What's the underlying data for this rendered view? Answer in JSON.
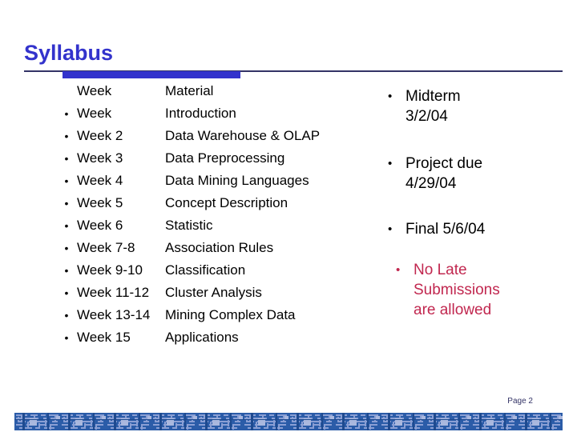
{
  "slide": {
    "title": "Syllabus",
    "page_number": "Page 2",
    "title_color": "#3333CC",
    "accent_color": "#C1274F",
    "rule_color": "#333366",
    "footer_band_color": "#2B5CA8"
  },
  "schedule": {
    "bullet_glyph": "•",
    "header": {
      "week": "Week",
      "material": "Material"
    },
    "rows": [
      {
        "week": "Week",
        "material": "Introduction"
      },
      {
        "week": "Week 2",
        "material": "Data Warehouse & OLAP"
      },
      {
        "week": "Week 3",
        "material": "Data Preprocessing"
      },
      {
        "week": "Week 4",
        "material": "Data Mining Languages"
      },
      {
        "week": "Week 5",
        "material": "Concept Description"
      },
      {
        "week": "Week 6",
        "material": "Statistic"
      },
      {
        "week": "Week 7-8",
        "material": "Association Rules"
      },
      {
        "week": "Week 9-10",
        "material": "Classification"
      },
      {
        "week": "Week 11-12",
        "material": "Cluster Analysis"
      },
      {
        "week": "Week 13-14",
        "material": "Mining Complex Data"
      },
      {
        "week": "Week 15",
        "material": "Applications"
      }
    ]
  },
  "notes": {
    "bullet_glyph": "•",
    "items": [
      {
        "line1": "Midterm",
        "line2": "3/2/04",
        "line3": "",
        "accent": false
      },
      {
        "line1": "Project due",
        "line2": "4/29/04",
        "line3": "",
        "accent": false
      },
      {
        "line1": "Final 5/6/04",
        "line2": "",
        "line3": "",
        "accent": false
      },
      {
        "line1": "No Late",
        "line2": "Submissions",
        "line3": "are allowed",
        "accent": true
      }
    ]
  }
}
